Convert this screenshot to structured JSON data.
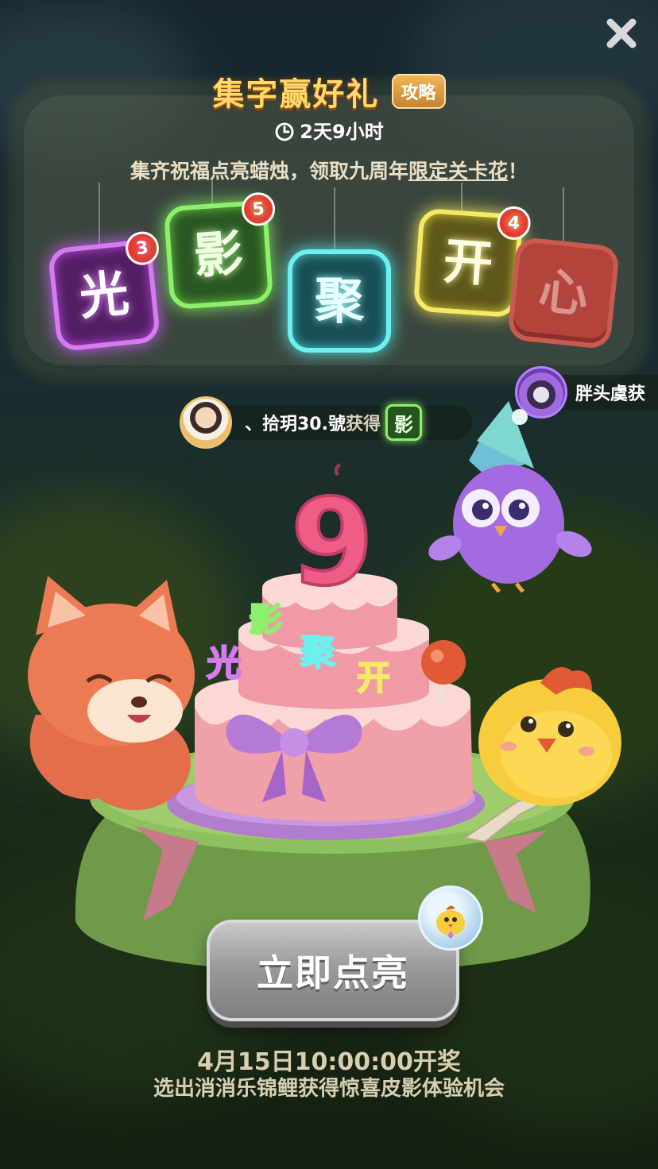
{
  "header": {
    "title": "集字赢好礼",
    "guide_label": "攻略",
    "timer": "2天9小时",
    "subtitle_prefix": "集齐祝福点亮蜡烛，领取九周年",
    "subtitle_link": "限定关卡花",
    "subtitle_suffix": "！"
  },
  "tiles": [
    {
      "char": "光",
      "badge": "3",
      "lit": true,
      "color": "#d67af0"
    },
    {
      "char": "影",
      "badge": "5",
      "lit": true,
      "color": "#8ef06a"
    },
    {
      "char": "聚",
      "badge": "",
      "lit": true,
      "color": "#6df0ee"
    },
    {
      "char": "开",
      "badge": "4",
      "lit": true,
      "color": "#f4ea63"
    },
    {
      "char": "心",
      "badge": "",
      "lit": false,
      "color": "#b2443b"
    }
  ],
  "feed": [
    {
      "user": "、拾玥30.號",
      "action": "获得",
      "char": "影"
    },
    {
      "user": "胖头虞获"
    }
  ],
  "cake": {
    "candle_number": "9",
    "toppers": [
      "光",
      "影",
      "聚",
      "开"
    ]
  },
  "cta": {
    "label": "立即点亮"
  },
  "footer": {
    "draw_time": "4月15日10:00:00开奖",
    "draw_desc": "选出消消乐锦鲤获得惊喜皮影体验机会"
  },
  "icons": {
    "close": "close-icon",
    "clock": "clock-icon",
    "chick": "chick-icon"
  },
  "colors": {
    "title": "#ffd86a",
    "badge": "#e23a2f",
    "button_disabled": "#9b9b9b"
  }
}
